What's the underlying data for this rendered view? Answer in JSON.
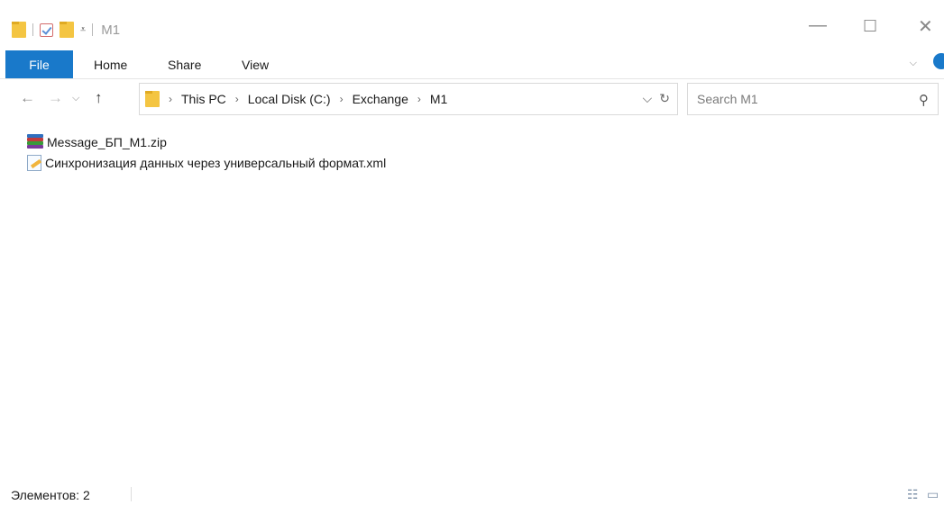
{
  "window": {
    "title": "M1",
    "minimize_glyph": "—",
    "maximize_glyph": "☐",
    "close_glyph": "✕"
  },
  "ribbon": {
    "tabs": [
      {
        "label": "File",
        "active": true
      },
      {
        "label": "Home"
      },
      {
        "label": "Share"
      },
      {
        "label": "View"
      }
    ],
    "accent_color": "#1979ca"
  },
  "address_bar": {
    "breadcrumbs": [
      "This PC",
      "Local Disk (C:)",
      "Exchange",
      "M1"
    ],
    "separator": "›"
  },
  "search": {
    "placeholder": "Search M1"
  },
  "files": [
    {
      "name": "Message_БП_M1.zip",
      "icon": "winrar-archive-icon"
    },
    {
      "name": "Синхронизация данных через универсальный формат.xml",
      "icon": "xml-document-icon"
    }
  ],
  "status": {
    "items_text": "Элементов: 2"
  }
}
